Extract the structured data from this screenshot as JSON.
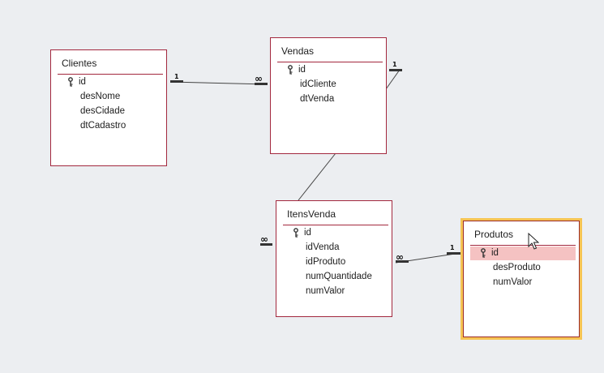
{
  "tables": {
    "clientes": {
      "name": "Clientes",
      "fields": [
        "id",
        "desNome",
        "desCidade",
        "dtCadastro"
      ]
    },
    "vendas": {
      "name": "Vendas",
      "fields": [
        "id",
        "idCliente",
        "dtVenda"
      ]
    },
    "itensvenda": {
      "name": "ItensVenda",
      "fields": [
        "id",
        "idVenda",
        "idProduto",
        "numQuantidade",
        "numValor"
      ]
    },
    "produtos": {
      "name": "Produtos",
      "fields": [
        "id",
        "desProduto",
        "numValor"
      ],
      "selected": true,
      "highlighted_field": "id"
    }
  },
  "relationships": [
    {
      "from": "clientes.id",
      "to": "vendas.idCliente",
      "one_label": "1",
      "many_label": "∞"
    },
    {
      "from": "vendas.id",
      "to": "itensvenda.idVenda",
      "one_label": "1",
      "many_label": "∞"
    },
    {
      "from": "produtos.id",
      "to": "itensvenda.idProduto",
      "one_label": "1",
      "many_label": "∞"
    }
  ],
  "icons": {
    "primary_key": "key-icon",
    "pointer": "mouse-pointer-icon"
  },
  "colors": {
    "table_border": "#a3283e",
    "selection_glow": "#f6c453",
    "selected_row": "#f5c2c2",
    "background": "#eceef1"
  }
}
